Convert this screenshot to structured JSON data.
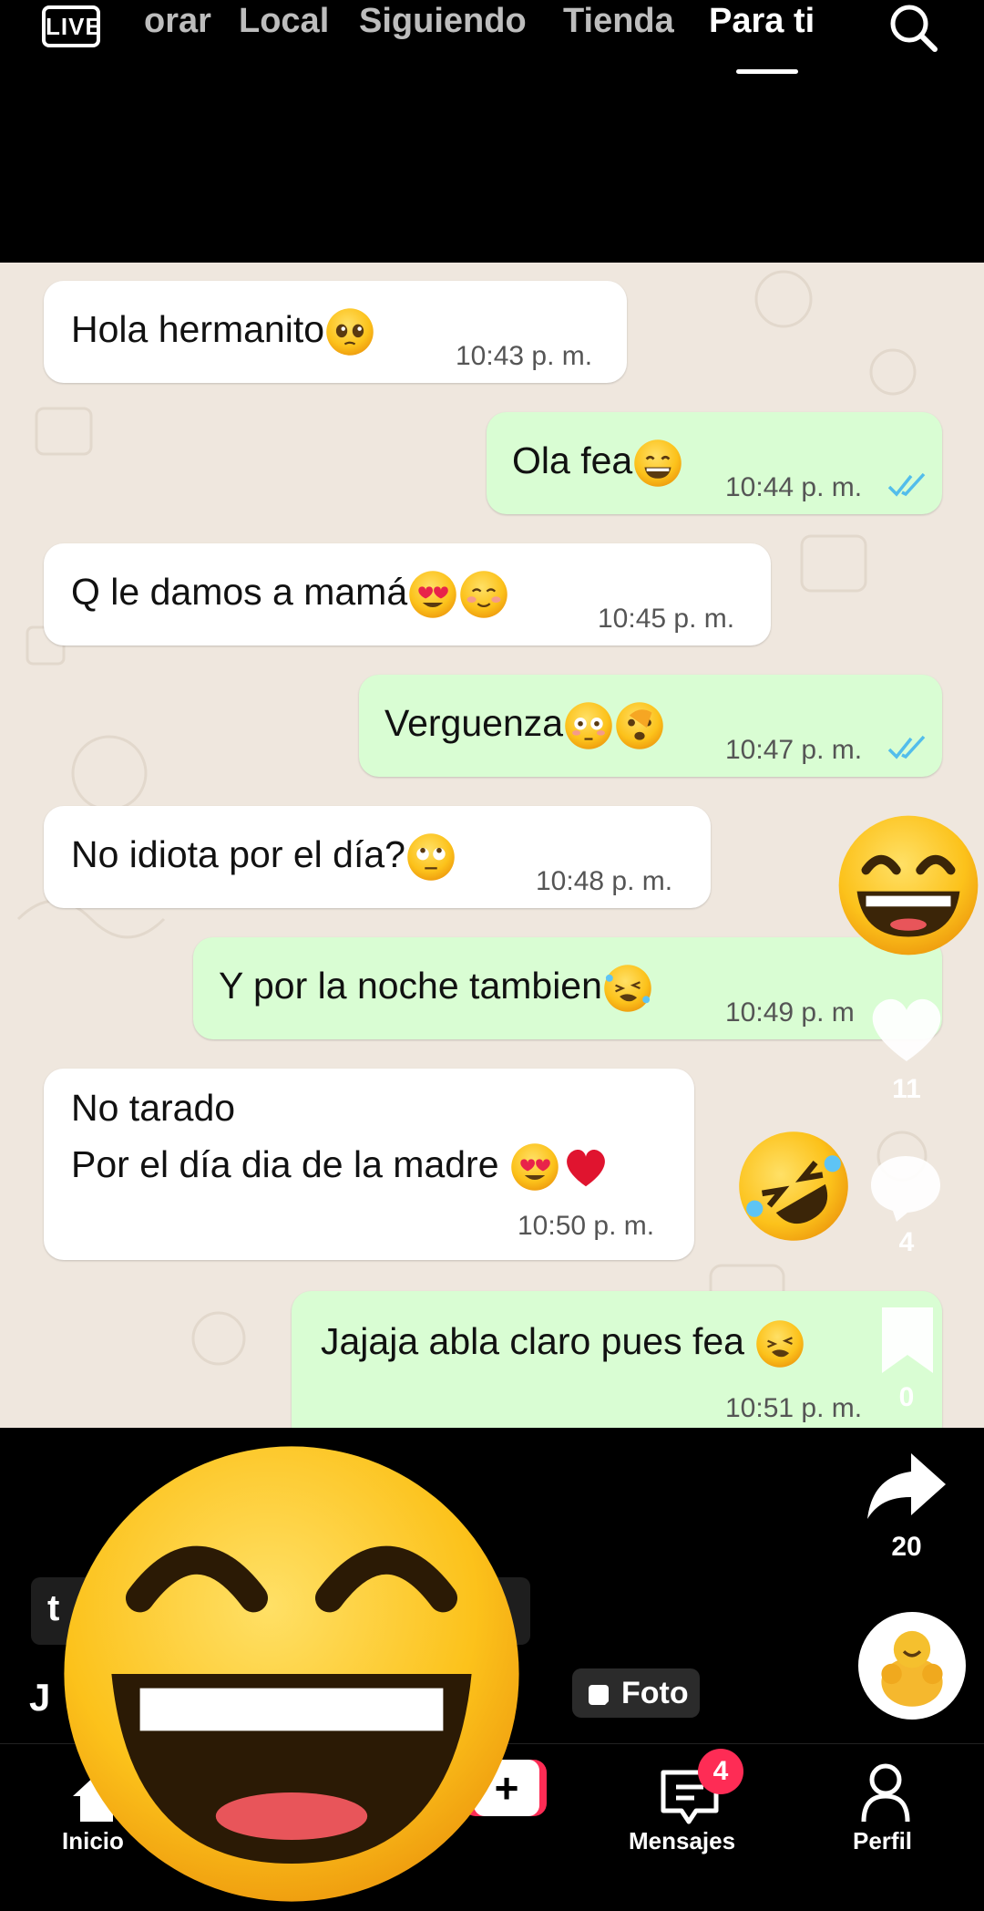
{
  "topnav": {
    "live": "LIVE",
    "tabs": [
      "orar",
      "Local",
      "Siguiendo",
      "Tienda",
      "Para ti"
    ],
    "active_tab": "Para ti"
  },
  "chat": {
    "messages": [
      {
        "dir": "in",
        "text": "Hola hermanito",
        "time": "10:43 p. m."
      },
      {
        "dir": "out",
        "text": "Ola fea",
        "time": "10:44 p. m."
      },
      {
        "dir": "in",
        "text": "Q le damos a mamá",
        "time": "10:45 p. m."
      },
      {
        "dir": "out",
        "text": "Verguenza",
        "time": "10:47 p. m."
      },
      {
        "dir": "in",
        "text": "No idiota por el día?",
        "time": "10:48 p. m."
      },
      {
        "dir": "out",
        "text": "Y por la noche tambien",
        "time": "10:49 p. m"
      },
      {
        "dir": "in",
        "line1": "No tarado",
        "line2": "Por el día dia de la madre",
        "time": "10:50 p. m."
      },
      {
        "dir": "out",
        "text": "Jajaja abla claro pues fea",
        "time": "10:51 p. m."
      }
    ]
  },
  "actions": {
    "likes": "11",
    "comments": "4",
    "saves": "0",
    "shares": "20"
  },
  "caption": {
    "text": "t",
    "author": "J",
    "foto": "Foto"
  },
  "bottomnav": {
    "home": "Inicio",
    "messages": "Mensajes",
    "messages_badge": "4",
    "profile": "Perfil"
  },
  "colors": {
    "accent": "#fe2c55",
    "chat_bg": "#efe7de",
    "bubble_out": "#d9fdd3",
    "tick_blue": "#53bdeb"
  }
}
